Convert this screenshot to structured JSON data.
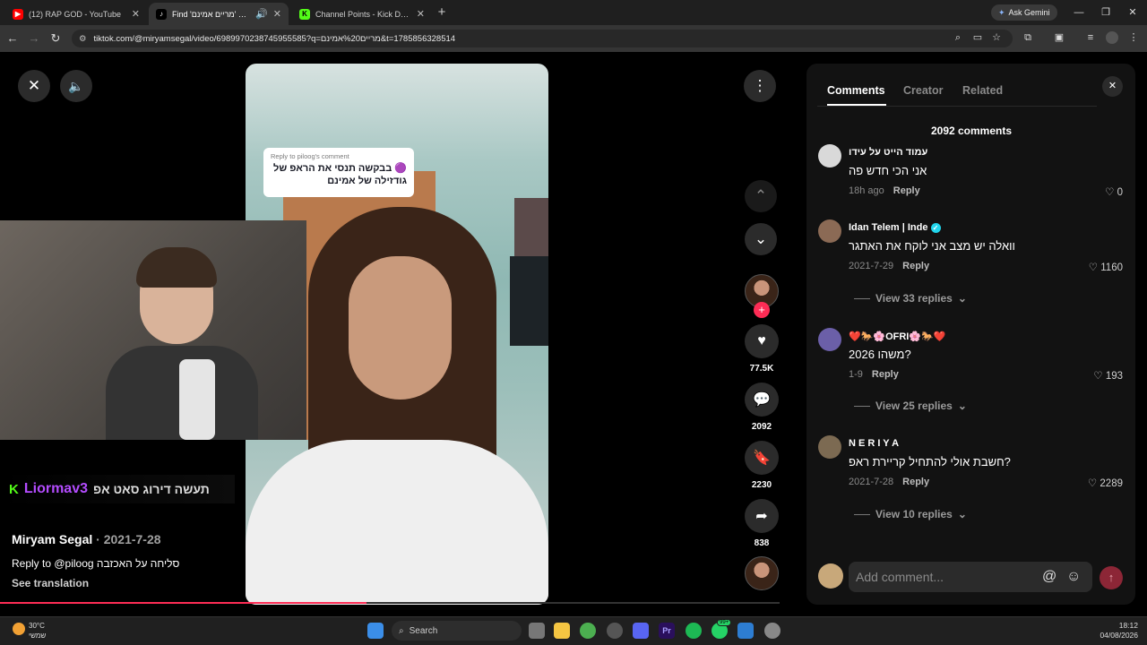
{
  "browser": {
    "tabs": [
      {
        "label": "(12) RAP GOD - YouTube",
        "favicon": "youtube-icon"
      },
      {
        "label": "Find 'מריים אמינם' on TikTo",
        "favicon": "tiktok-icon"
      },
      {
        "label": "Channel Points - Kick Dashboard",
        "favicon": "kick-icon"
      }
    ],
    "ask_gemini": "Ask Gemini",
    "url": "tiktok.com/@miryamsegal/video/6989970238745955585?q=מריים%20אמינם&t=1785856328514"
  },
  "reply_overlay": {
    "ref": "Reply to piloog's comment",
    "text": "🟣 בבקשה תנסי את הראפ של גודזילה של אמינם"
  },
  "kick_chat": {
    "username": "Liormav3",
    "message": "תעשה דירוג סאט אפ"
  },
  "video_meta": {
    "author": "Miryam Segal",
    "date": "2021-7-28",
    "caption_prefix": "Reply to @piloog",
    "caption_text": "סליחה על האכזבה",
    "see_translation": "See translation",
    "progress_fraction": 0.47
  },
  "rail": {
    "likes": "77.5K",
    "comments": "2092",
    "saves": "2230",
    "shares": "838"
  },
  "panel": {
    "tabs": [
      "Comments",
      "Creator",
      "Related"
    ],
    "count_label": "2092 comments",
    "comments": [
      {
        "name": "עמוד הייט על עידו",
        "text": "אני הכי חדש פה",
        "time": "18h ago",
        "reply": "Reply",
        "likes": "0",
        "verified": false
      },
      {
        "name": "Idan Telem | Inde",
        "text": "וואלה יש מצב אני לוקח את האתגר",
        "time": "2021-7-29",
        "reply": "Reply",
        "likes": "1160",
        "verified": true,
        "view_replies": "View 33 replies"
      },
      {
        "name": "❤️🐎🌸OFRI🌸🐎❤️",
        "text": "2026 משהו?",
        "time": "1-9",
        "reply": "Reply",
        "likes": "193",
        "verified": false,
        "view_replies": "View 25 replies"
      },
      {
        "name": "N E R I Y A",
        "text": "חשבת אולי להתחיל קריירת ראפ?",
        "time": "2021-7-28",
        "reply": "Reply",
        "likes": "2289",
        "verified": false,
        "view_replies": "View 10 replies"
      }
    ],
    "add_comment_placeholder": "Add comment..."
  },
  "taskbar": {
    "temp": "30°C",
    "weather_label": "שמשי",
    "search_label": "Search",
    "time": "18:12",
    "date": "04/08/2026",
    "whatsapp_badge": "99+"
  },
  "colors": {
    "accent_red": "#fe2c55",
    "kick_green": "#53fc18",
    "kick_user_purple": "#b44cff"
  }
}
